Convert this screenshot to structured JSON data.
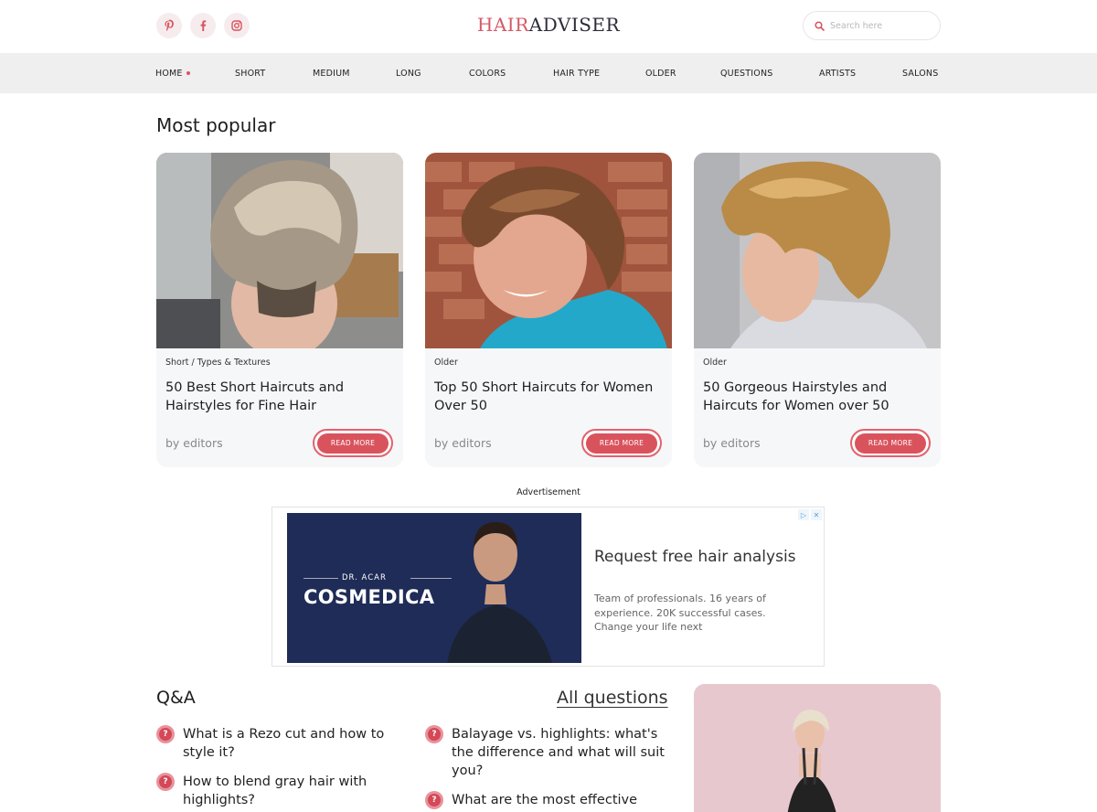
{
  "header": {
    "logo_part1": "HAIR",
    "logo_part2": "ADVISER",
    "search_placeholder": "Search here",
    "social_icons": [
      "pinterest-icon",
      "facebook-icon",
      "instagram-icon"
    ]
  },
  "nav": {
    "items": [
      "HOME",
      "SHORT",
      "MEDIUM",
      "LONG",
      "COLORS",
      "HAIR TYPE",
      "OLDER",
      "QUESTIONS",
      "ARTISTS",
      "SALONS"
    ],
    "active_index": 0
  },
  "popular": {
    "title": "Most popular",
    "cards": [
      {
        "category": "Short / Types & Textures",
        "title": "50 Best Short Haircuts and Hairstyles for Fine Hair",
        "byline": "by editors",
        "button": "READ MORE"
      },
      {
        "category": "Older",
        "title": "Top 50 Short Haircuts for Women Over 50",
        "byline": "by editors",
        "button": "READ MORE"
      },
      {
        "category": "Older",
        "title": "50 Gorgeous Hairstyles and Haircuts for Women over 50",
        "byline": "by editors",
        "button": "READ MORE"
      }
    ]
  },
  "ad": {
    "label": "Advertisement",
    "brand_small": "DR. ACAR",
    "brand": "COSMEDICA",
    "headline": "Request free hair analysis",
    "description": "Team of professionals. 16 years of experience. 20K successful cases. Change your life next",
    "choices": [
      "▷",
      "✕"
    ]
  },
  "qa": {
    "title": "Q&A",
    "all_link": "All questions",
    "questions_left": [
      "What is a Rezo cut and how to style it?",
      "How to blend gray hair with highlights?"
    ],
    "questions_right": [
      "Balayage vs. highlights: what's the difference and what will suit you?",
      "What are the most effective"
    ],
    "question_icon": "?"
  },
  "colors": {
    "accent": "#d9535d",
    "nav_bg": "#efefef",
    "card_bg": "#f6f7f9",
    "promo_bg": "#e8c8cf"
  }
}
